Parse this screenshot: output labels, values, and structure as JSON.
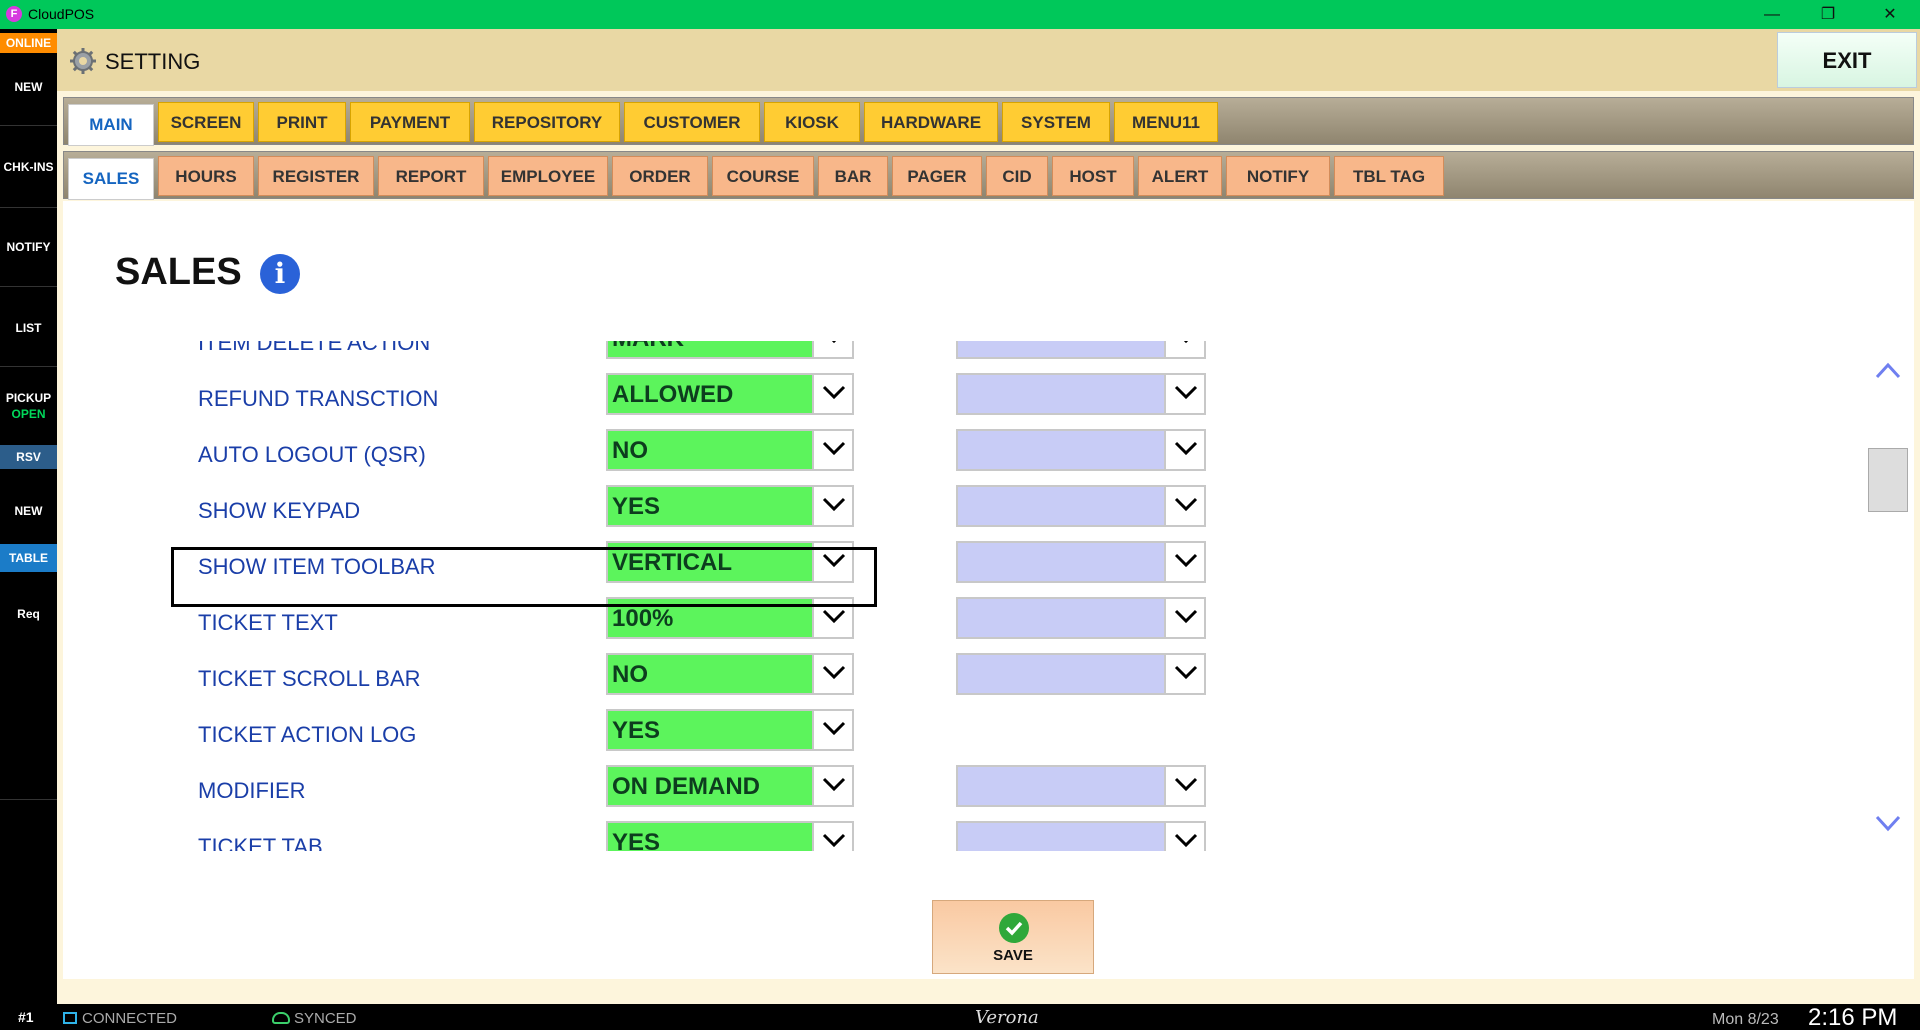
{
  "window": {
    "title": "CloudPOS",
    "app_icon": "F"
  },
  "rail": {
    "online": "ONLINE",
    "items": [
      "NEW",
      "CHK-INS",
      "NOTIFY",
      "LIST",
      "PICKUP",
      "RSV",
      "NEW",
      "TABLE",
      "Req"
    ],
    "pickup_status": "OPEN"
  },
  "header": {
    "title": "SETTING",
    "exit_label": "EXIT"
  },
  "tabs_primary": [
    "MAIN",
    "SCREEN",
    "PRINT",
    "PAYMENT",
    "REPOSITORY",
    "CUSTOMER",
    "KIOSK",
    "HARDWARE",
    "SYSTEM",
    "MENU11"
  ],
  "tabs_secondary": [
    "SALES",
    "HOURS",
    "REGISTER",
    "REPORT",
    "EMPLOYEE",
    "ORDER",
    "COURSE",
    "BAR",
    "PAGER",
    "CID",
    "HOST",
    "ALERT",
    "NOTIFY",
    "TBL TAG"
  ],
  "section": {
    "title": "SALES"
  },
  "settings": [
    {
      "label": "ITEM DELETE ACTION",
      "value": "MARK"
    },
    {
      "label": "REFUND TRANSCTION",
      "value": "ALLOWED"
    },
    {
      "label": "AUTO LOGOUT (QSR)",
      "value": "NO"
    },
    {
      "label": "SHOW KEYPAD",
      "value": "YES"
    },
    {
      "label": "SHOW ITEM TOOLBAR",
      "value": "VERTICAL"
    },
    {
      "label": "TICKET TEXT",
      "value": "100%"
    },
    {
      "label": "TICKET SCROLL BAR",
      "value": "NO"
    },
    {
      "label": "TICKET ACTION LOG",
      "value": "YES"
    },
    {
      "label": "MODIFIER",
      "value": "ON DEMAND"
    },
    {
      "label": "TICKET TAB",
      "value": "YES"
    }
  ],
  "save_label": "SAVE",
  "status": {
    "station": "#1",
    "connection": "CONNECTED",
    "sync": "SYNCED",
    "location": "Verona",
    "date": "Mon 8/23",
    "time": "2:16 PM"
  },
  "colors": {
    "titlebar": "#00c85a",
    "select_value_bg": "#5cf45c",
    "select_secondary_bg": "#c8ccf6",
    "active_tab_text": "#1565c0"
  }
}
